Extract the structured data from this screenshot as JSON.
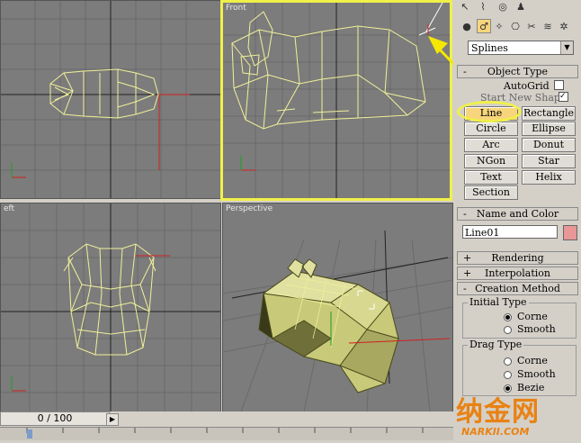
{
  "viewports": {
    "top": {
      "label": ""
    },
    "front": {
      "label": "Front"
    },
    "left": {
      "label": "eft"
    },
    "perspective": {
      "label": "Perspective"
    }
  },
  "panel": {
    "category_dropdown": "Splines",
    "object_type": {
      "title": "Object Type",
      "autogrid_label": "AutoGrid",
      "start_new_shape_label": "Start New Shape",
      "buttons": [
        "Line",
        "Rectangle",
        "Circle",
        "Ellipse",
        "Arc",
        "Donut",
        "NGon",
        "Star",
        "Text",
        "Helix",
        "Section"
      ],
      "selected_button": "Line"
    },
    "name_and_color": {
      "title": "Name and Color",
      "name_value": "Line01",
      "color": "#e89696"
    },
    "rendering": {
      "title": "Rendering"
    },
    "interpolation": {
      "title": "Interpolation"
    },
    "creation_method": {
      "title": "Creation Method",
      "initial_type_label": "Initial Type",
      "initial_options": [
        "Corne",
        "Smooth"
      ],
      "initial_selected": "Corne",
      "drag_type_label": "Drag Type",
      "drag_options": [
        "Corne",
        "Smooth",
        "Bezie"
      ],
      "drag_selected": "Bezie"
    }
  },
  "timeline": {
    "slider_text": "0 / 100"
  },
  "watermark": {
    "big": "纳金网",
    "small": "NARKII.COM"
  },
  "colors": {
    "active_border": "#f0f04a",
    "wire": "#f0f09a",
    "highlight": "#f7d57c",
    "arrow": "#f5e800"
  }
}
